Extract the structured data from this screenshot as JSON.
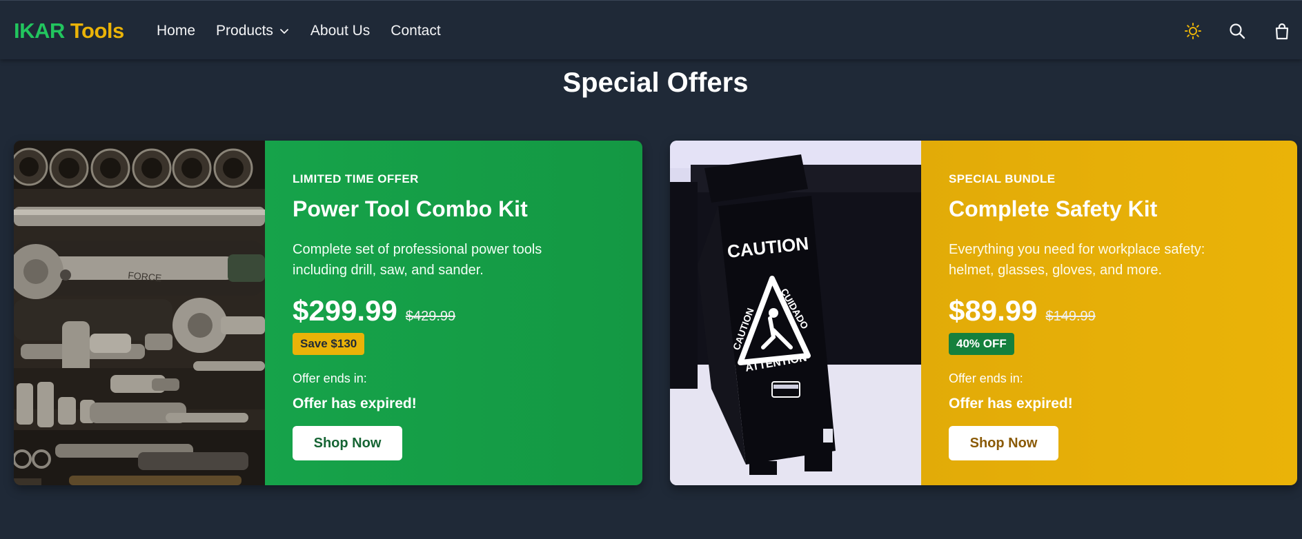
{
  "brand": {
    "part1": "IKAR",
    "part2": "Tools"
  },
  "nav": {
    "items": [
      {
        "label": "Home"
      },
      {
        "label": "Products",
        "has_dropdown": true
      },
      {
        "label": "About Us"
      },
      {
        "label": "Contact"
      }
    ],
    "icons": [
      "sun-icon",
      "search-icon",
      "shopping-bag-icon"
    ],
    "cart_count": "0"
  },
  "section": {
    "title": "Special Offers"
  },
  "offers": [
    {
      "eyebrow": "LIMITED TIME OFFER",
      "title": "Power Tool Combo Kit",
      "description": "Complete set of professional power tools including drill, saw, and sander.",
      "price": "$299.99",
      "old_price": "$429.99",
      "badge": "Save $130",
      "ends_label": "Offer ends in:",
      "status": "Offer has expired!",
      "cta": "Shop Now",
      "image": "socket-wrench-set-photo",
      "color": "#16a34a"
    },
    {
      "eyebrow": "SPECIAL BUNDLE",
      "title": "Complete Safety Kit",
      "description": "Everything you need for workplace safety: helmet, glasses, gloves, and more.",
      "price": "$89.99",
      "old_price": "$149.99",
      "badge": "40% OFF",
      "ends_label": "Offer ends in:",
      "status": "Offer has expired!",
      "cta": "Shop Now",
      "image": "caution-wet-floor-sign-photo",
      "color": "#eab308",
      "sign_text": {
        "top": "CAUTION",
        "tri_left": "CAUTION",
        "tri_right": "CUIDADO",
        "tri_bottom": "ATTENTION"
      }
    }
  ],
  "colors": {
    "background": "#1f2937",
    "brand_green": "#22c55e",
    "brand_yellow": "#eab308",
    "offer_green": "#16a34a",
    "offer_yellow": "#eab308"
  }
}
